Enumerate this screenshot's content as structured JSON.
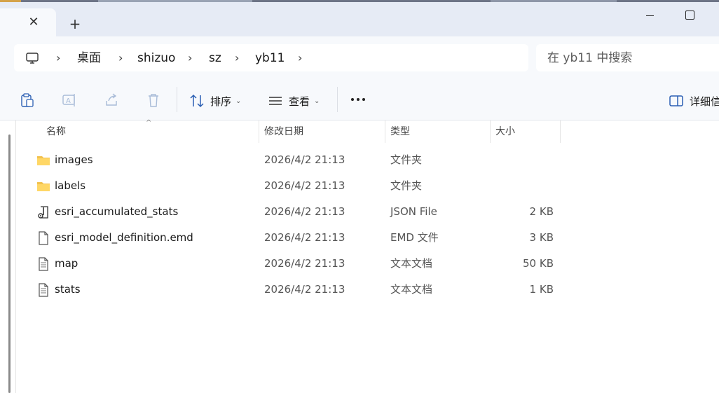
{
  "tabs": {
    "close_glyph": "✕",
    "new_glyph": "+"
  },
  "breadcrumb": {
    "items": [
      "桌面",
      "shizuo",
      "sz",
      "yb11"
    ],
    "separator": "›"
  },
  "search": {
    "placeholder": "在 yb11 中搜索"
  },
  "toolbar": {
    "sort_label": "排序",
    "view_label": "查看",
    "details_label": "详细信",
    "chevron": "⌄"
  },
  "columns": {
    "name": "名称",
    "modified": "修改日期",
    "type": "类型",
    "size": "大小"
  },
  "files": [
    {
      "name": "images",
      "modified": "2026/4/2 21:13",
      "type": "文件夹",
      "size": "",
      "icon": "folder-icon"
    },
    {
      "name": "labels",
      "modified": "2026/4/2 21:13",
      "type": "文件夹",
      "size": "",
      "icon": "folder-icon"
    },
    {
      "name": "esri_accumulated_stats",
      "modified": "2026/4/2 21:13",
      "type": "JSON File",
      "size": "2 KB",
      "icon": "json-file-icon"
    },
    {
      "name": "esri_model_definition.emd",
      "modified": "2026/4/2 21:13",
      "type": "EMD 文件",
      "size": "3 KB",
      "icon": "blank-file-icon"
    },
    {
      "name": "map",
      "modified": "2026/4/2 21:13",
      "type": "文本文档",
      "size": "50 KB",
      "icon": "text-file-icon"
    },
    {
      "name": "stats",
      "modified": "2026/4/2 21:13",
      "type": "文本文档",
      "size": "1 KB",
      "icon": "text-file-icon"
    }
  ],
  "colors": {
    "titlebar": "#e6ebf5",
    "toolbar": "#f7f9fc",
    "folder": "#f2c14e"
  }
}
